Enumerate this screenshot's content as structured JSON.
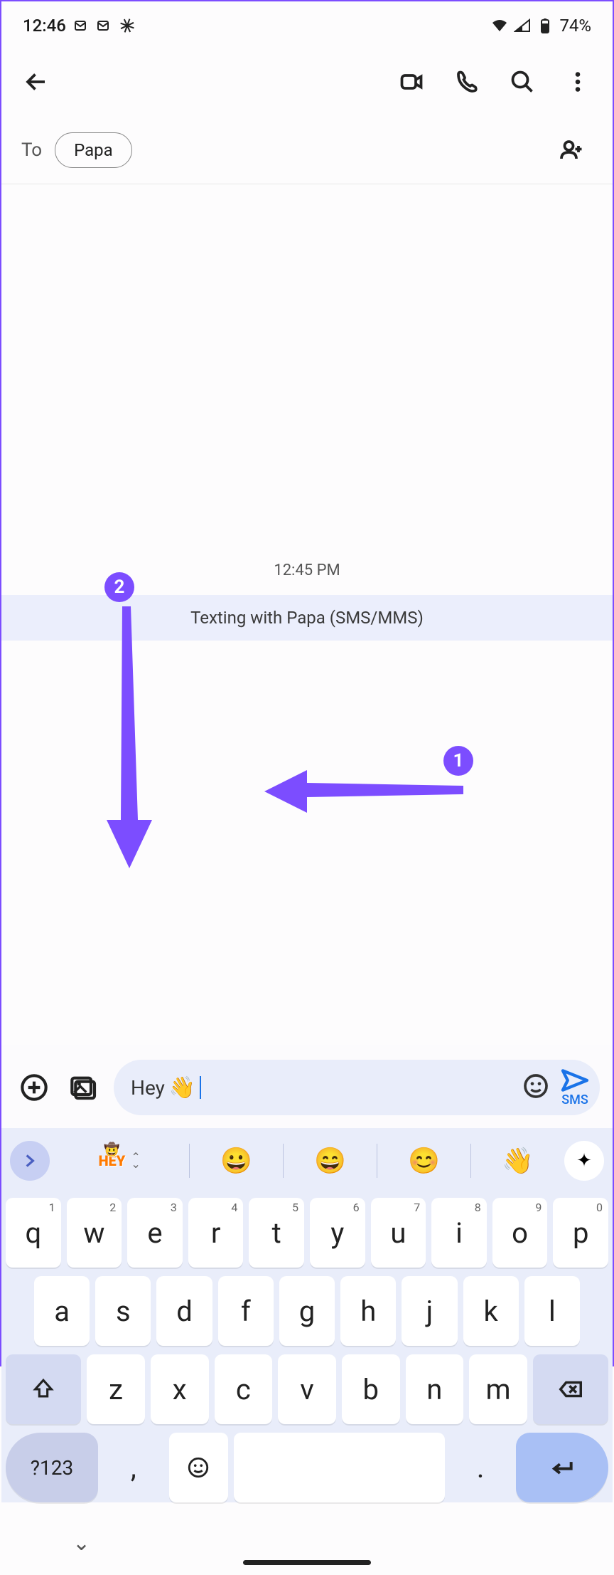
{
  "status": {
    "time": "12:46",
    "battery_pct": "74%"
  },
  "to": {
    "label": "To",
    "chip": "Papa"
  },
  "conversation": {
    "timestamp": "12:45 PM",
    "banner": "Texting with Papa (SMS/MMS)"
  },
  "input": {
    "text": "Hey",
    "emoji": "👋",
    "send_label": "SMS"
  },
  "suggestions": {
    "sticker_text": "HEY",
    "emojis": [
      "😀",
      "😄",
      "😊",
      "👋"
    ]
  },
  "keyboard": {
    "row1": [
      {
        "k": "q",
        "n": "1"
      },
      {
        "k": "w",
        "n": "2"
      },
      {
        "k": "e",
        "n": "3"
      },
      {
        "k": "r",
        "n": "4"
      },
      {
        "k": "t",
        "n": "5"
      },
      {
        "k": "y",
        "n": "6"
      },
      {
        "k": "u",
        "n": "7"
      },
      {
        "k": "i",
        "n": "8"
      },
      {
        "k": "o",
        "n": "9"
      },
      {
        "k": "p",
        "n": "0"
      }
    ],
    "row2": [
      "a",
      "s",
      "d",
      "f",
      "g",
      "h",
      "j",
      "k",
      "l"
    ],
    "row3": [
      "z",
      "x",
      "c",
      "v",
      "b",
      "n",
      "m"
    ],
    "symbols": "?123",
    "comma": ",",
    "period": "."
  },
  "annotations": {
    "badge1": "1",
    "badge2": "2"
  }
}
